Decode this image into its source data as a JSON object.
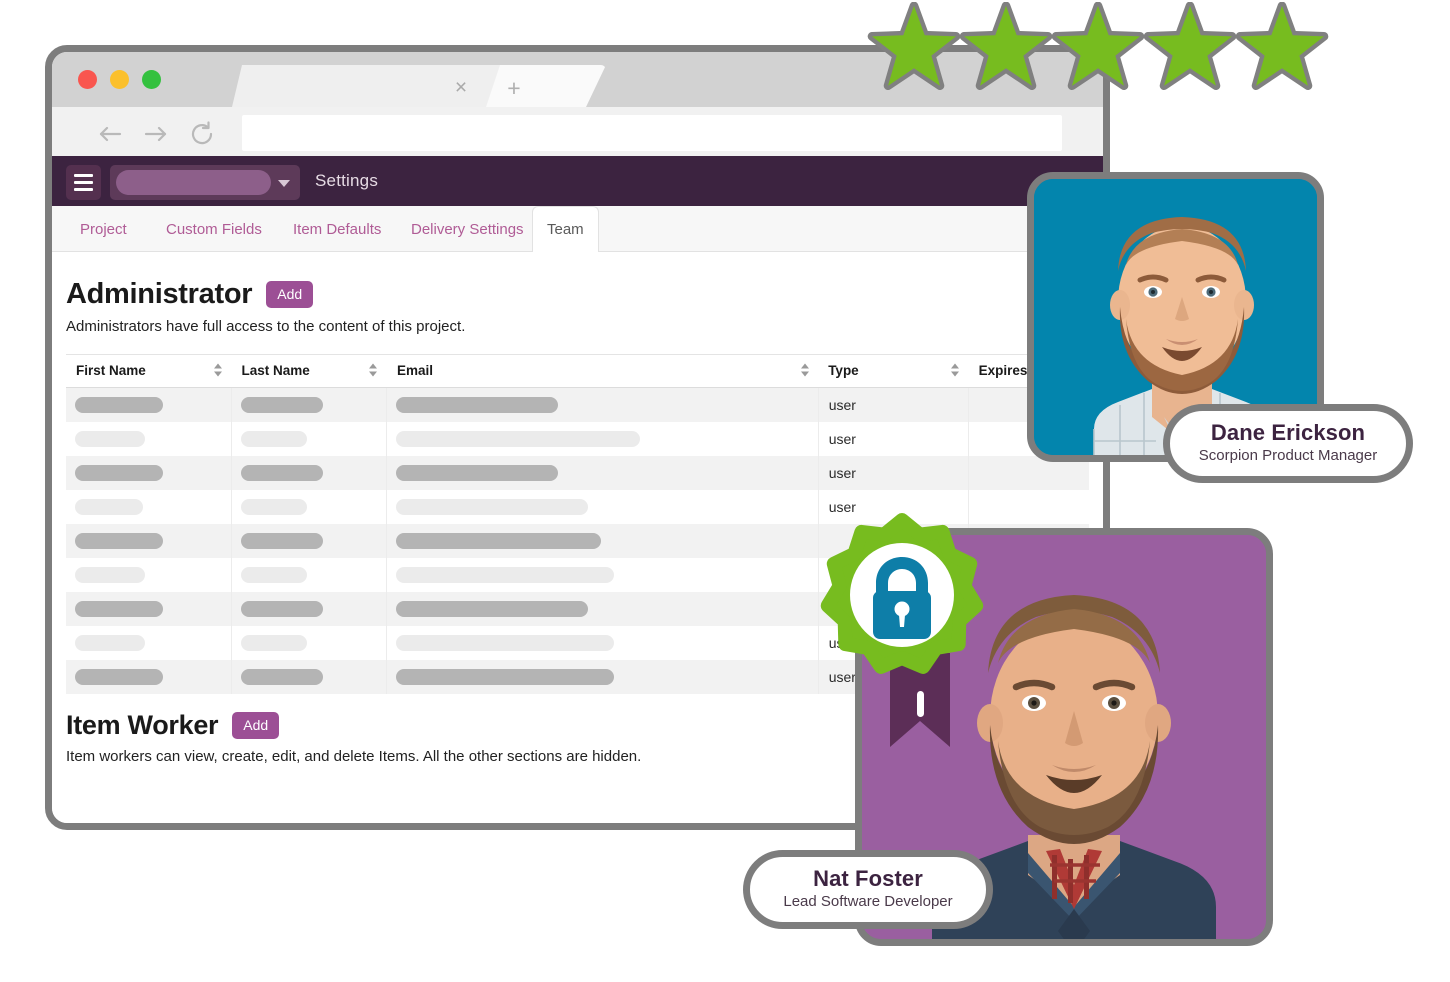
{
  "browser": {
    "traffic_lights": [
      "close",
      "minimize",
      "maximize"
    ],
    "tab_close_glyph": "×",
    "tab_new_glyph": "+",
    "url_value": "",
    "url_placeholder": "",
    "nav": {
      "back": "back-arrow",
      "forward": "forward-arrow",
      "reload": "reload-arrow"
    }
  },
  "app_header": {
    "menu_icon": "hamburger-icon",
    "project_selector_value": "",
    "title": "Settings"
  },
  "tabs": [
    {
      "label": "Project",
      "active": false
    },
    {
      "label": "Custom Fields",
      "active": false
    },
    {
      "label": "Item Defaults",
      "active": false
    },
    {
      "label": "Delivery Settings",
      "active": false
    },
    {
      "label": "Team",
      "active": true
    }
  ],
  "sections": [
    {
      "title": "Administrator",
      "add_label": "Add",
      "description": "Administrators have full access to the content of this project."
    },
    {
      "title": "Item Worker",
      "add_label": "Add",
      "description": "Item workers can view, create, edit, and delete Items. All the other sections are hidden."
    }
  ],
  "table": {
    "columns": [
      {
        "label": "First Name",
        "sortable": true
      },
      {
        "label": "Last Name",
        "sortable": true
      },
      {
        "label": "Email",
        "sortable": true
      },
      {
        "label": "Type",
        "sortable": true
      },
      {
        "label": "Expires",
        "sortable": false
      }
    ],
    "rows": [
      {
        "first_name": "",
        "last_name": "",
        "email": "",
        "type": "user",
        "expires": "",
        "w1": 88,
        "w2": 82,
        "w3": 162,
        "shade": "dark"
      },
      {
        "first_name": "",
        "last_name": "",
        "email": "",
        "type": "user",
        "expires": "",
        "w1": 70,
        "w2": 66,
        "w3": 244,
        "shade": "light"
      },
      {
        "first_name": "",
        "last_name": "",
        "email": "",
        "type": "user",
        "expires": "",
        "w1": 88,
        "w2": 82,
        "w3": 162,
        "shade": "dark"
      },
      {
        "first_name": "",
        "last_name": "",
        "email": "",
        "type": "user",
        "expires": "",
        "w1": 68,
        "w2": 66,
        "w3": 192,
        "shade": "light"
      },
      {
        "first_name": "",
        "last_name": "",
        "email": "",
        "type": "",
        "expires": "",
        "w1": 88,
        "w2": 82,
        "w3": 205,
        "shade": "dark"
      },
      {
        "first_name": "",
        "last_name": "",
        "email": "",
        "type": "",
        "expires": "",
        "w1": 70,
        "w2": 66,
        "w3": 218,
        "shade": "light"
      },
      {
        "first_name": "",
        "last_name": "",
        "email": "",
        "type": "",
        "expires": "",
        "w1": 88,
        "w2": 82,
        "w3": 192,
        "shade": "dark"
      },
      {
        "first_name": "",
        "last_name": "",
        "email": "",
        "type": "user",
        "expires": "",
        "w1": 70,
        "w2": 66,
        "w3": 218,
        "shade": "light"
      },
      {
        "first_name": "",
        "last_name": "",
        "email": "",
        "type": "user",
        "expires": "",
        "w1": 88,
        "w2": 82,
        "w3": 218,
        "shade": "dark"
      }
    ]
  },
  "people": [
    {
      "name": "Dane Erickson",
      "role": "Scorpion Product Manager",
      "card_color": "#0385ad"
    },
    {
      "name": "Nat Foster",
      "role": "Lead Software Developer",
      "card_color": "#9a5fa0"
    }
  ],
  "badges": {
    "stars": {
      "count": 5,
      "color": "#77bc1f",
      "icon": "star-icon"
    },
    "security": {
      "icon": "lock-icon",
      "badge_color": "#77bc1f",
      "lock_color": "#0e7ea8",
      "ribbon_color": "#5c2e57"
    }
  },
  "colors": {
    "brand_purple": "#3c2340",
    "accent_purple": "#9c4f95",
    "tab_link": "#b05c96",
    "green": "#77bc1f",
    "teal": "#0385ad"
  }
}
